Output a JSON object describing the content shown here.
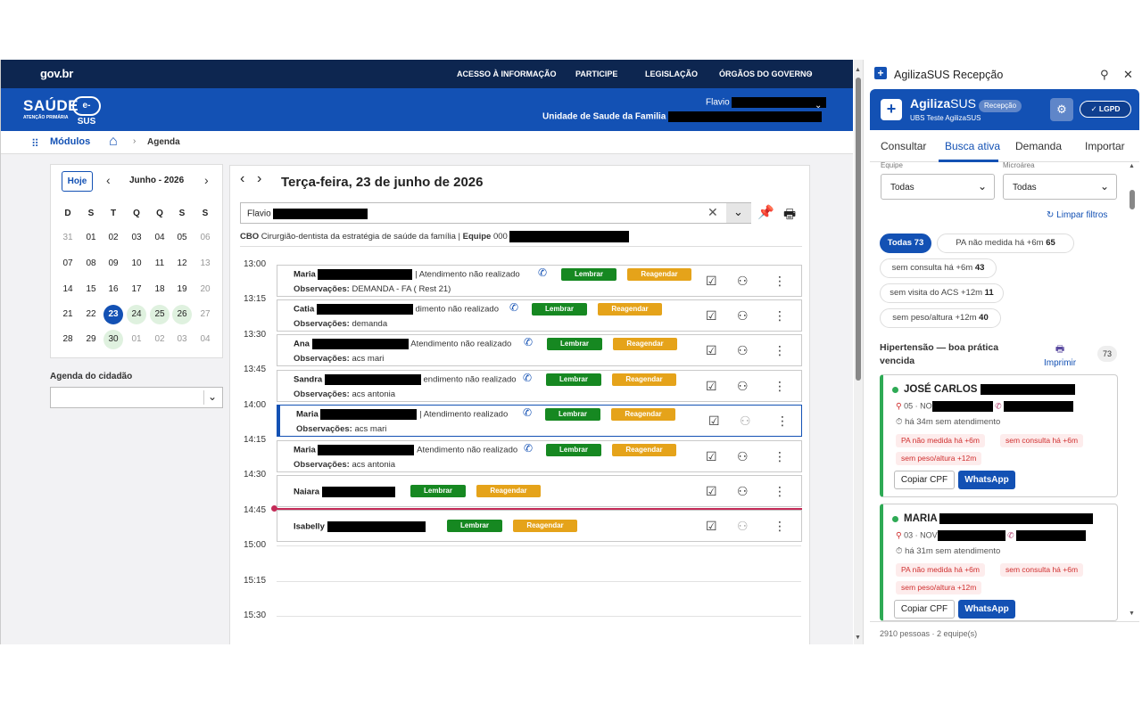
{
  "gov": {
    "logo": "gov.br",
    "links": [
      "ACESSO À INFORMAÇÃO",
      "PARTICIPE",
      "LEGISLAÇÃO",
      "ÓRGÃOS DO GOVERNO"
    ]
  },
  "header": {
    "brand": "SAÚDE",
    "brand_sub": "ATENÇÃO PRIMÁRIA",
    "esus": "e-SUS",
    "user": "Flavio",
    "unit": "Unidade de Saude da Familia"
  },
  "nav": {
    "modules": "Módulos",
    "crumb": "Agenda"
  },
  "calendar": {
    "today_button": "Hoje",
    "month": "Junho - 2026",
    "weekdays": [
      "D",
      "S",
      "T",
      "Q",
      "Q",
      "S",
      "S"
    ],
    "weeks": [
      [
        "31",
        "01",
        "02",
        "03",
        "04",
        "05",
        "06"
      ],
      [
        "07",
        "08",
        "09",
        "10",
        "11",
        "12",
        "13"
      ],
      [
        "14",
        "15",
        "16",
        "17",
        "18",
        "19",
        "20"
      ],
      [
        "21",
        "22",
        "23",
        "24",
        "25",
        "26",
        "27"
      ],
      [
        "28",
        "29",
        "30",
        "01",
        "02",
        "03",
        "04"
      ]
    ]
  },
  "agenda_cidadao": {
    "label": "Agenda do cidadão"
  },
  "schedule": {
    "date": "Terça-feira, 23 de junho de 2026",
    "professional": "Flavio",
    "cbo_label": "CBO",
    "cbo_value": "Cirurgião-dentista da estratégia de saúde da família",
    "equipe_label": "Equipe",
    "equipe_value": "000",
    "times": [
      "13:00",
      "13:15",
      "13:30",
      "13:45",
      "14:00",
      "14:15",
      "14:30",
      "14:45",
      "15:00",
      "15:15",
      "15:30"
    ],
    "obs_label": "Observações:",
    "remind": "Lembrar",
    "reschedule": "Reagendar",
    "appointments": [
      {
        "name": "Maria",
        "status": "| Atendimento não realizado",
        "obs": "DEMANDA - FA ( Rest 21)"
      },
      {
        "name": "Catia",
        "status": "dimento não realizado",
        "obs": "demanda"
      },
      {
        "name": "Ana",
        "status": "Atendimento não realizado",
        "obs": "acs mari"
      },
      {
        "name": "Sandra",
        "status": "endimento não realizado",
        "obs": "acs antonia"
      },
      {
        "name": "Maria",
        "status": "| Atendimento realizado",
        "obs": "acs mari"
      },
      {
        "name": "Maria",
        "status": "Atendimento não realizado",
        "obs": "acs antonia"
      },
      {
        "name": "Naiara",
        "status": "",
        "obs": ""
      },
      {
        "name": "Isabelly",
        "status": "",
        "obs": ""
      }
    ]
  },
  "panel": {
    "title": "AgilizaSUS Recepção",
    "app_name": "Agiliza",
    "app_name_suffix": "SUS",
    "badge": "Recepção",
    "ubs": "UBS Teste AgilizaSUS",
    "lgpd": "LGPD",
    "tabs": [
      "Consultar",
      "Busca ativa",
      "Demanda",
      "Importar"
    ],
    "active_tab": "Busca ativa",
    "equipe_label": "Equipe",
    "equipe_value": "Todas",
    "micro_label": "Microárea",
    "micro_value": "Todas",
    "clear_filters": "Limpar filtros",
    "chips": [
      {
        "label": "Todas",
        "count": "73"
      },
      {
        "label": "PA não medida há +6m",
        "count": "65"
      },
      {
        "label": "sem consulta há +6m",
        "count": "43"
      },
      {
        "label": "sem visita do ACS +12m",
        "count": "11"
      },
      {
        "label": "sem peso/altura +12m",
        "count": "40"
      }
    ],
    "group_line1": "Hipertensão — boa prática",
    "group_line2": "vencida",
    "print": "Imprimir",
    "group_count": "73",
    "cards": [
      {
        "name": "JOSÉ CARLOS",
        "addr": "05 · NO",
        "last": "há 34m sem atendimento",
        "alerts": [
          "PA não medida há +6m",
          "sem consulta há +6m",
          "sem peso/altura +12m"
        ]
      },
      {
        "name": "MARIA",
        "addr": "03 · NOV",
        "last": "há 31m sem atendimento",
        "alerts": [
          "PA não medida há +6m",
          "sem consulta há +6m",
          "sem peso/altura +12m"
        ]
      }
    ],
    "copy_cpf": "Copiar CPF",
    "whatsapp": "WhatsApp",
    "footer": "2910 pessoas · 2 equipe(s)"
  },
  "colors": {
    "gov_dark": "#0d2650",
    "brand_blue": "#1351b4",
    "green": "#168821",
    "orange": "#e5a31a",
    "now_line": "#c42b58"
  }
}
